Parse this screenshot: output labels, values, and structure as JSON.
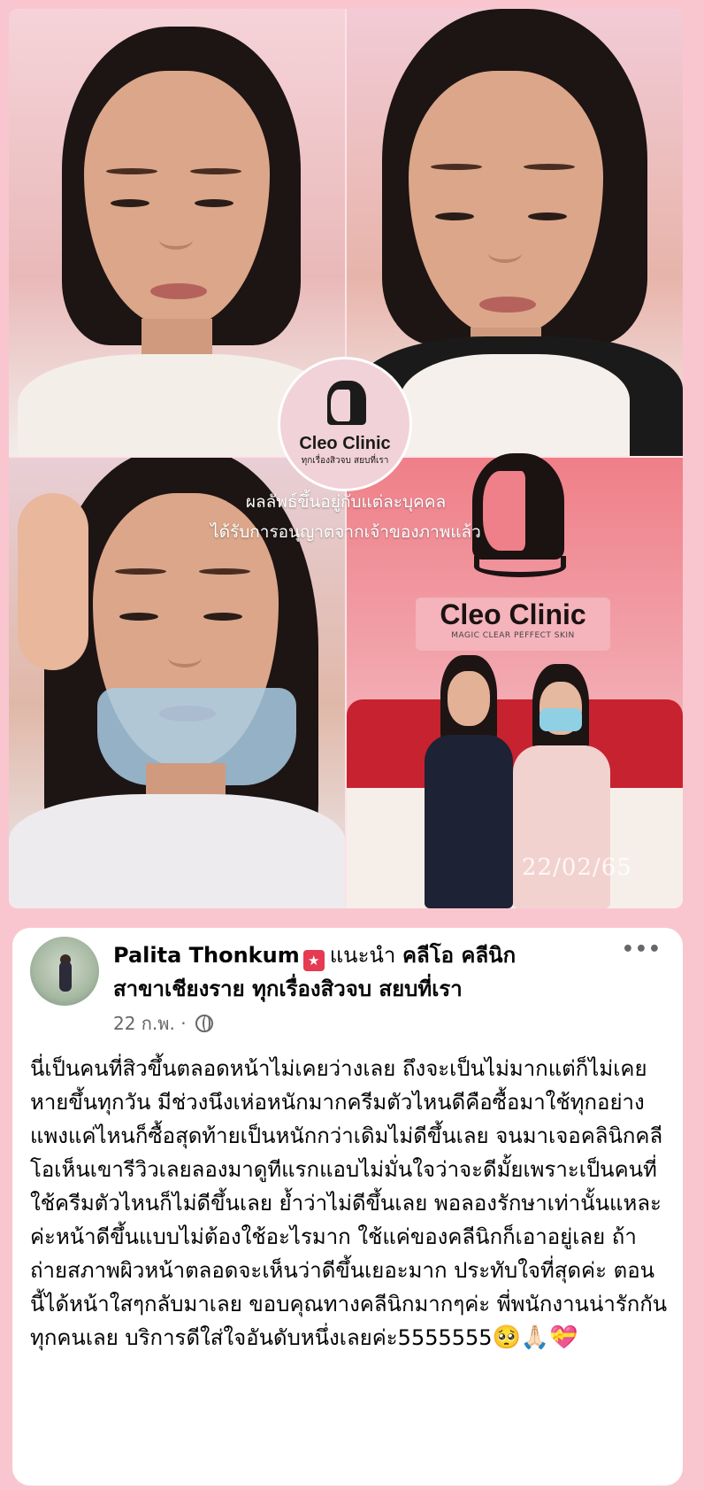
{
  "collage": {
    "overlay_line1": "ผลลัพธ์ขึ้นอยู่กับแต่ละบุคคล",
    "overlay_line2": "ได้รับการอนุญาตจากเจ้าของภาพแล้ว",
    "date_stamp": "22/02/65",
    "logo": {
      "name": "Cleo Clinic",
      "tagline": "ทุกเรื่องสิวจบ สยบที่เรา"
    },
    "wall_logo": {
      "name": "Cleo Clinic",
      "tagline": "MAGIC CLEAR PEFFECT SKIN"
    }
  },
  "post": {
    "author": "Palita Thonkum",
    "recommends": "แนะนำ",
    "page_name_line1": "คลีโอ คลีนิก",
    "page_name_line2": "สาขาเชียงราย ทุกเรื่องสิวจบ สยบที่เรา",
    "date": "22 ก.พ.",
    "separator": "·",
    "more": "•••",
    "body": "นี่เป็นคนที่สิวขึ้นตลอดหน้าไม่เคยว่างเลย ถึงจะเป็นไม่มากแต่ก็ไม่เคยหายขึ้นทุกวัน มีช่วงนึงเห่อหนักมากครีมตัวไหนดีคือซื้อมาใช้ทุกอย่าง แพงแค่ไหนก็ซื้อสุดท้ายเป็นหนักกว่าเดิมไม่ดีขึ้นเลย จนมาเจอคลินิกคลีโอเห็นเขารีวิวเลยลองมาดูทีแรกแอบไม่มั่นใจว่าจะดีมั้ยเพราะเป็นคนที่ใช้ครีมตัวไหนก็ไม่ดีขึ้นเลย ย้ำว่าไม่ดีขึ้นเลย พอลองรักษาเท่านั้นแหละค่ะหน้าดีขึ้นแบบไม่ต้องใช้อะไรมาก ใช้แค่ของคลีนิกก็เอาอยู่เลย ถ้าถ่ายสภาพผิวหน้าตลอดจะเห็นว่าดีขึ้นเยอะมาก ประทับใจที่สุดค่ะ ตอนนี้ได้หน้าใสๆกลับมาเลย ขอบคุณทางคลีนิกมากๆค่ะ พี่พนักงานน่ารักกันทุกคนเลย บริการดีใส่ใจอันดับหนึ่งเลยค่ะ5555555",
    "emojis": "🥺🙏🏻💝"
  },
  "colors": {
    "page_bg": "#f9c6cf",
    "card_bg": "#ffffff",
    "badge": "#e63a52",
    "muted": "#65676b"
  }
}
